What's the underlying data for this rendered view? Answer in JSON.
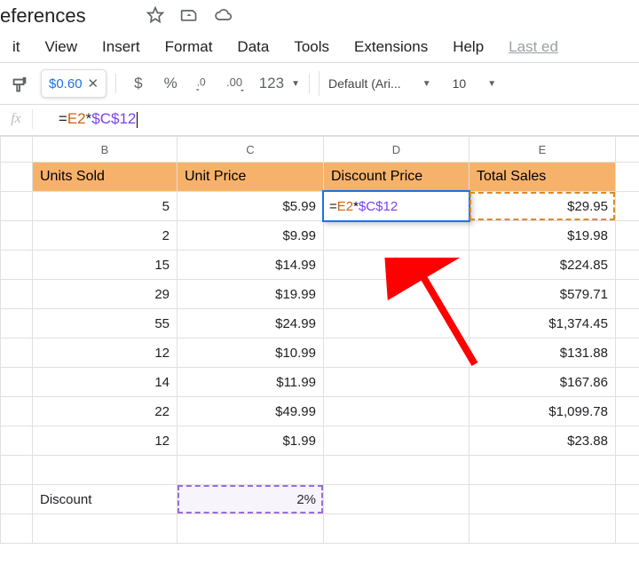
{
  "title_fragment": "eferences",
  "menubar": [
    "it",
    "View",
    "Insert",
    "Format",
    "Data",
    "Tools",
    "Extensions",
    "Help"
  ],
  "menubar_last": "Last ed",
  "preview_value": "$0.60",
  "formula": {
    "eq": "=",
    "ref1": "E2",
    "op": "*",
    "ref2": "$C$12"
  },
  "toolbar": {
    "dollar": "$",
    "percent": "%",
    "num_fmt": "123",
    "font_label": "Default (Ari...",
    "font_size": "10"
  },
  "columns": [
    "",
    "B",
    "C",
    "D",
    "E",
    ""
  ],
  "headers": {
    "b": "Units Sold",
    "c": "Unit Price",
    "d": "Discount Price",
    "e": "Total Sales"
  },
  "rows": [
    {
      "b": "5",
      "c": "$5.99",
      "e": "$29.95"
    },
    {
      "b": "2",
      "c": "$9.99",
      "e": "$19.98"
    },
    {
      "b": "15",
      "c": "$14.99",
      "e": "$224.85"
    },
    {
      "b": "29",
      "c": "$19.99",
      "e": "$579.71"
    },
    {
      "b": "55",
      "c": "$24.99",
      "e": "$1,374.45"
    },
    {
      "b": "12",
      "c": "$10.99",
      "e": "$131.88"
    },
    {
      "b": "14",
      "c": "$11.99",
      "e": "$167.86"
    },
    {
      "b": "22",
      "c": "$49.99",
      "e": "$1,099.78"
    },
    {
      "b": "12",
      "c": "$1.99",
      "e": "$23.88"
    }
  ],
  "discount_row": {
    "label": "Discount",
    "value": "2%"
  }
}
